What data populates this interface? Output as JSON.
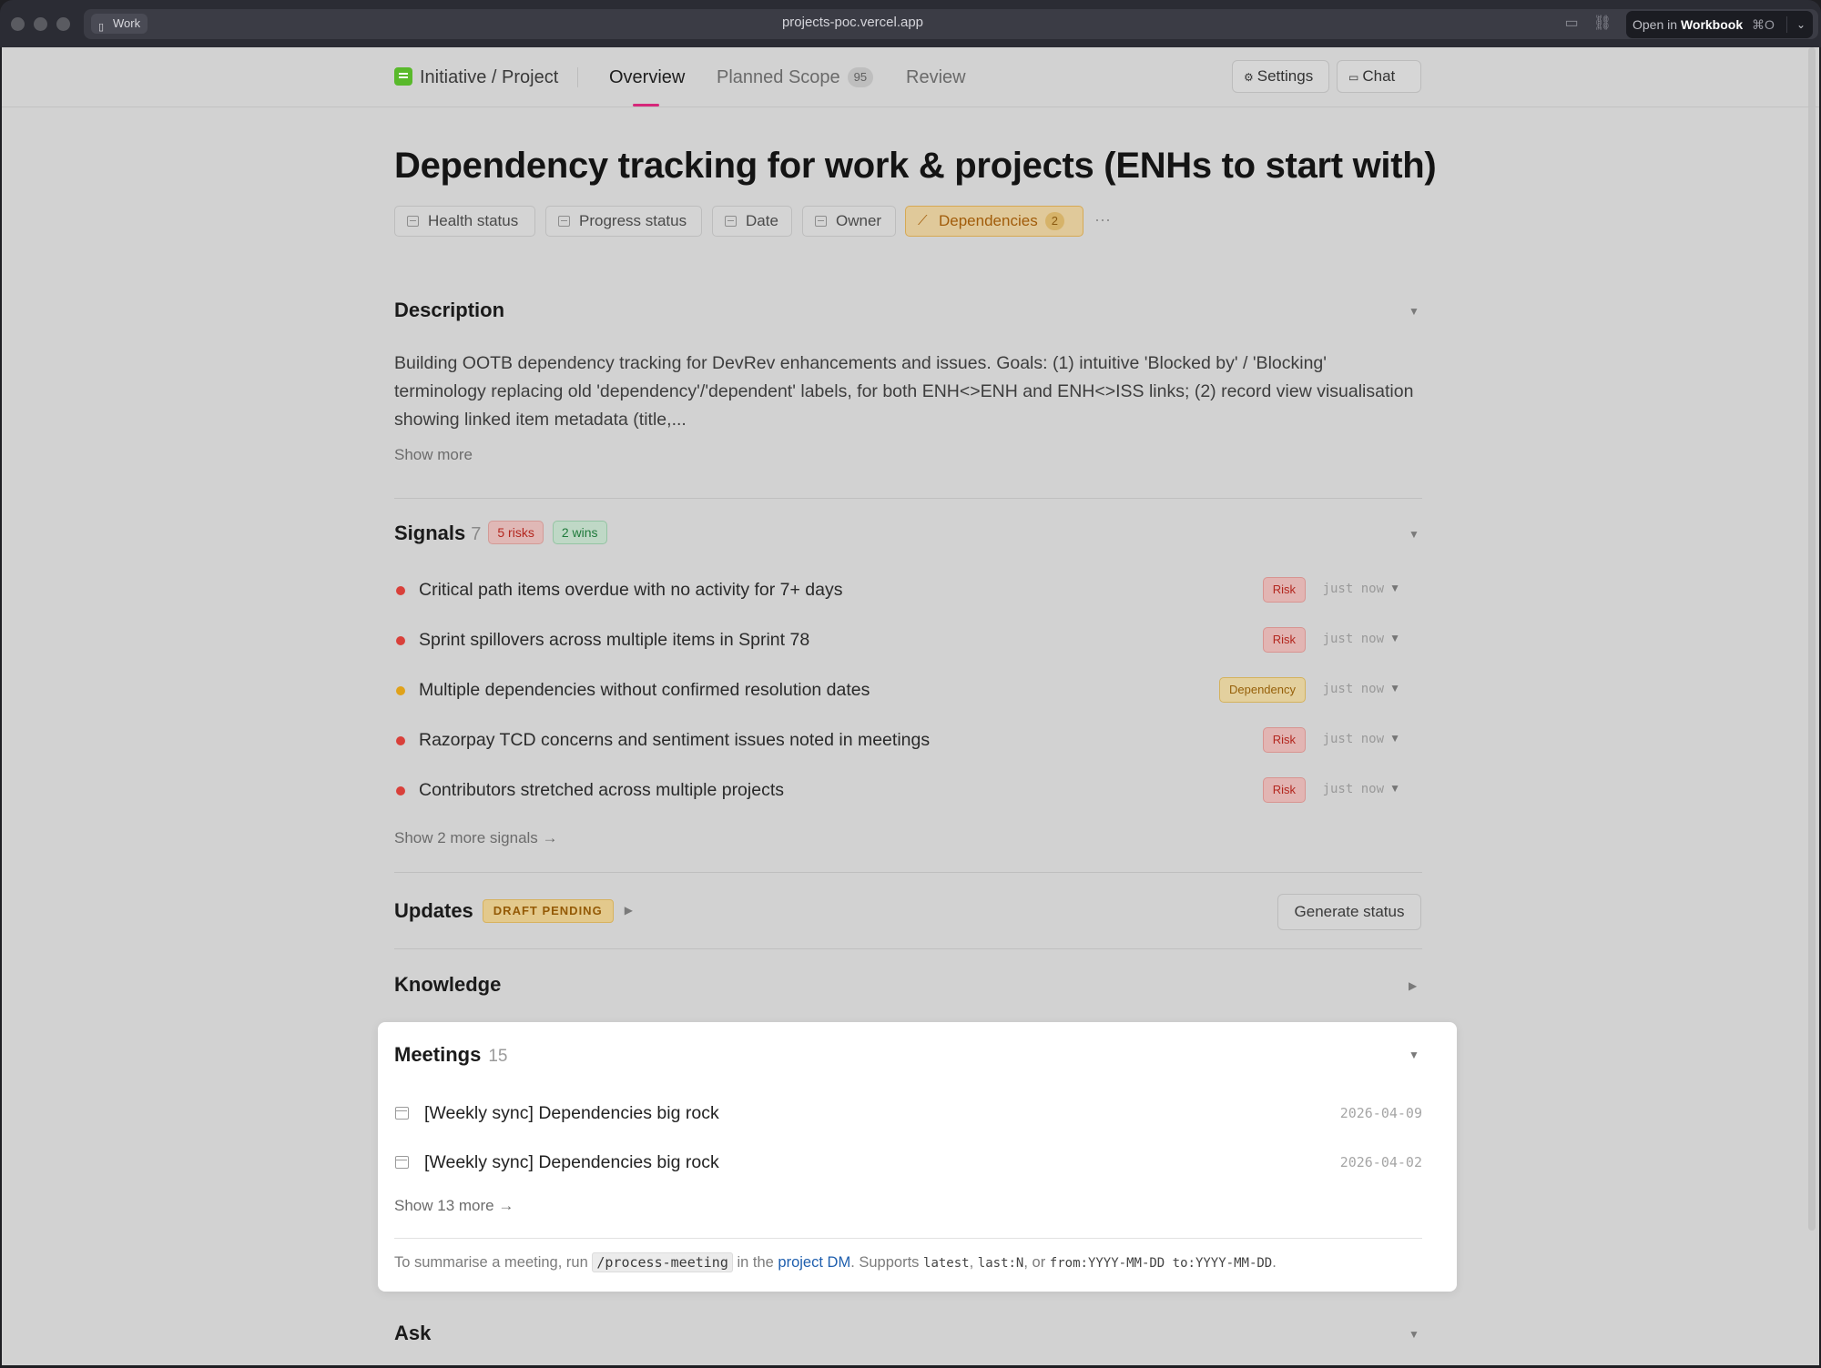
{
  "browser": {
    "workspace_tag": "Work",
    "url": "projects-poc.vercel.app",
    "open_in_prefix": "Open in",
    "open_in_app": "Workbook",
    "open_in_shortcut": "⌘O"
  },
  "nav": {
    "breadcrumb": "Initiative / Project",
    "tabs": [
      {
        "label": "Overview",
        "active": true
      },
      {
        "label": "Planned Scope",
        "count": "95"
      },
      {
        "label": "Review"
      }
    ],
    "settings_label": "Settings",
    "chat_label": "Chat"
  },
  "project": {
    "title": "Dependency tracking for work & projects (ENHs to start with)",
    "chips": [
      {
        "label": "Health status"
      },
      {
        "label": "Progress status"
      },
      {
        "label": "Date"
      },
      {
        "label": "Owner"
      },
      {
        "label": "Dependencies",
        "count": "2"
      }
    ],
    "more": "···"
  },
  "description": {
    "heading": "Description",
    "text": "Building OOTB dependency tracking for DevRev enhancements and issues. Goals: (1) intuitive 'Blocked by' / 'Blocking' terminology replacing old 'dependency'/'dependent' labels, for both ENH<>ENH and ENH<>ISS links; (2) record view visualisation showing linked item metadata (title,...",
    "show_more": "Show more"
  },
  "signals": {
    "heading": "Signals",
    "count": "7",
    "risks_badge": "5 risks",
    "wins_badge": "2 wins",
    "items": [
      {
        "text": "Critical path items overdue with no activity for 7+ days",
        "tag": "Risk",
        "when": "just now",
        "color": "#d9403a"
      },
      {
        "text": "Sprint spillovers across multiple items in Sprint 78",
        "tag": "Risk",
        "when": "just now",
        "color": "#d9403a"
      },
      {
        "text": "Multiple dependencies without confirmed resolution dates",
        "tag": "Dependency",
        "when": "just now",
        "color": "#e0a21a"
      },
      {
        "text": "Razorpay TCD concerns and sentiment issues noted in meetings",
        "tag": "Risk",
        "when": "just now",
        "color": "#d9403a"
      },
      {
        "text": "Contributors stretched across multiple projects",
        "tag": "Risk",
        "when": "just now",
        "color": "#d9403a"
      }
    ],
    "show_more": "Show 2 more signals →"
  },
  "updates": {
    "heading": "Updates",
    "draft_badge": "DRAFT PENDING",
    "generate_label": "Generate status"
  },
  "knowledge": {
    "heading": "Knowledge"
  },
  "meetings": {
    "heading": "Meetings",
    "count": "15",
    "items": [
      {
        "title": "[Weekly sync] Dependencies big rock",
        "date": "2026-04-09"
      },
      {
        "title": "[Weekly sync] Dependencies big rock",
        "date": "2026-04-02"
      }
    ],
    "show_more": "Show 13 more →",
    "hint": {
      "prefix": "To summarise a meeting, run",
      "command": "/process-meeting",
      "middle": "in the",
      "link": "project DM",
      "supports": ". Supports",
      "opt1": "latest",
      "sep1": ",",
      "opt2": "last:N",
      "sep2": ", or",
      "opt3": "from:YYYY-MM-DD to:YYYY-MM-DD",
      "end": "."
    }
  },
  "ask": {
    "heading": "Ask"
  },
  "icons": {
    "expand": "▼",
    "collapse": "▶"
  }
}
